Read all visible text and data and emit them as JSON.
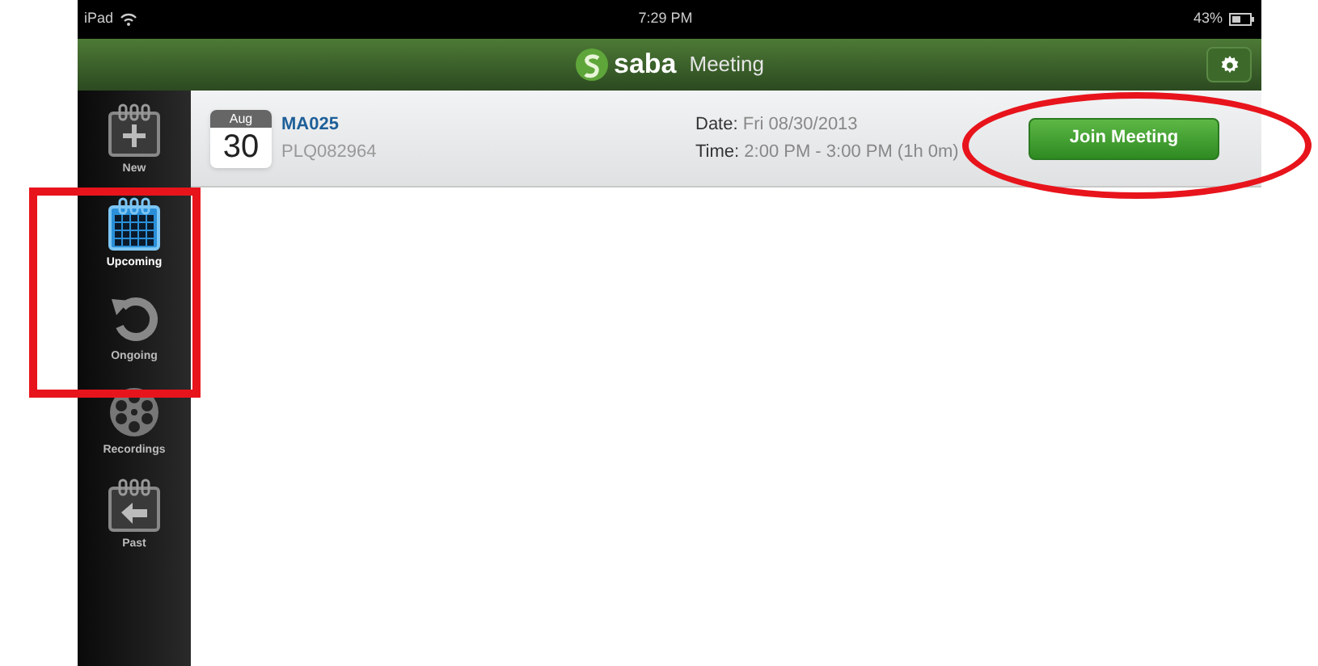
{
  "status_bar": {
    "device": "iPad",
    "time": "7:29 PM",
    "battery": "43%"
  },
  "header": {
    "brand": "saba",
    "title": "Meeting"
  },
  "sidebar": {
    "items": [
      {
        "label": "New",
        "kind": "new",
        "selected": false
      },
      {
        "label": "Upcoming",
        "kind": "upcoming",
        "selected": true
      },
      {
        "label": "Ongoing",
        "kind": "ongoing",
        "selected": false
      },
      {
        "label": "Recordings",
        "kind": "recordings",
        "selected": false
      },
      {
        "label": "Past",
        "kind": "past",
        "selected": false
      }
    ]
  },
  "meetings": [
    {
      "month": "Aug",
      "day": "30",
      "name": "MA025",
      "code": "PLQ082964",
      "date_label": "Date:",
      "date": "Fri 08/30/2013",
      "time_label": "Time:",
      "time": "2:00 PM - 3:00 PM (1h 0m)",
      "button": "Join Meeting"
    }
  ]
}
